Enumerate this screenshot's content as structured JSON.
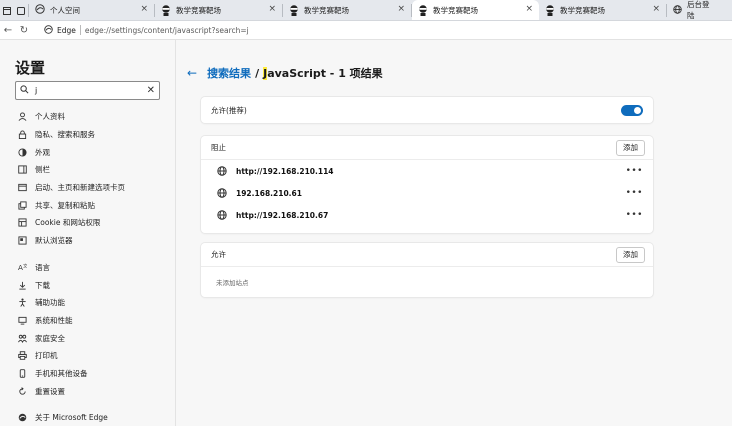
{
  "tabs": [
    {
      "title": "个人空间",
      "icon": "edge-favicon"
    },
    {
      "title": "教学竞赛靶场",
      "icon": "ninja-avatar"
    },
    {
      "title": "教学竞赛靶场",
      "icon": "ninja-avatar"
    },
    {
      "title": "教学竞赛靶场",
      "icon": "ninja-avatar"
    },
    {
      "title": "教学竞赛靶场",
      "icon": "ninja-avatar"
    },
    {
      "title": "后台登陆",
      "icon": "globe-icon"
    }
  ],
  "address_bar": {
    "brand": "Edge",
    "url": "edge://settings/content/javascript?search=j"
  },
  "sidebar": {
    "title": "设置",
    "search_value": "j",
    "items_group1": [
      {
        "label": "个人资料",
        "icon": "person-icon"
      },
      {
        "label": "隐私、搜索和服务",
        "icon": "lock-icon"
      },
      {
        "label": "外观",
        "icon": "appearance-icon"
      },
      {
        "label": "侧栏",
        "icon": "sidebar-icon"
      },
      {
        "label": "启动、主页和新建选项卡页",
        "icon": "home-icon"
      },
      {
        "label": "共享、复制和粘贴",
        "icon": "share-icon"
      },
      {
        "label": "Cookie 和网站权限",
        "icon": "cookie-icon"
      },
      {
        "label": "默认浏览器",
        "icon": "browser-icon"
      }
    ],
    "items_group2": [
      {
        "label": "语言",
        "icon": "language-icon"
      },
      {
        "label": "下载",
        "icon": "download-icon"
      },
      {
        "label": "辅助功能",
        "icon": "accessibility-icon"
      },
      {
        "label": "系统和性能",
        "icon": "system-icon"
      },
      {
        "label": "家庭安全",
        "icon": "family-icon"
      },
      {
        "label": "打印机",
        "icon": "printer-icon"
      },
      {
        "label": "手机和其他设备",
        "icon": "phone-icon"
      },
      {
        "label": "重置设置",
        "icon": "reset-icon"
      }
    ],
    "items_group3": [
      {
        "label": "关于 Microsoft Edge",
        "icon": "edge-icon"
      }
    ]
  },
  "main": {
    "breadcrumb_link": "搜索结果",
    "breadcrumb_slash": "/",
    "breadcrumb_highlight": "J",
    "breadcrumb_rest": "avaScript - 1 项结果",
    "allow_recommended_label": "允许(推荐)",
    "allow_recommended_on": true,
    "block_section": {
      "title": "阻止",
      "add_label": "添加",
      "sites": [
        "http://192.168.210.114",
        "192.168.210.61",
        "http://192.168.210.67"
      ]
    },
    "allow_section": {
      "title": "允许",
      "add_label": "添加",
      "empty_text": "未添加站点"
    }
  },
  "colors": {
    "accent": "#0f6cbd",
    "highlight": "#ffeb3b"
  }
}
